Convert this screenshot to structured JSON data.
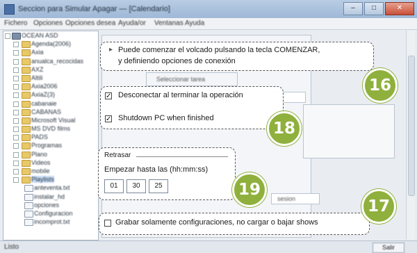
{
  "window": {
    "title": "Seccion para Simular Apagar — [Calendario]",
    "buttons": [
      "–",
      "□",
      "✕"
    ]
  },
  "menu": [
    "Fichero",
    "Opciones",
    "Opciones desea",
    "Ayuda/or",
    "Ventanas",
    "Ayuda"
  ],
  "tree": {
    "root": "OCEAN ASD",
    "items": [
      "Agenda(2006)",
      "Axia",
      "anualca_recocidas",
      "AXZ",
      "Altili",
      "Axia2006",
      "AxiaZ(3)",
      "cabanaie",
      "CABANAS",
      "Microsoft Visual",
      "MS DVD films",
      "PADS",
      "Programas",
      "Plano",
      "Videos",
      "mobile",
      "Playlists",
      "anteventa.txt",
      "instalar_hd",
      "opciones",
      "Configuracion",
      "incomprot.txt"
    ]
  },
  "background": {
    "group_label": "Seleccionar tarea",
    "side_label": "sesion",
    "statusbar_text": "Listo",
    "statusbar_button": "Salir"
  },
  "callouts": {
    "c16": {
      "line1": "Puede comenzar el volcado pulsando la tecla COMENZAR,",
      "line2": "y definiendo opciones de conexión",
      "number": "16"
    },
    "c18": {
      "option1": "Desconectar al terminar la operación",
      "option2": "Shutdown PC when finished",
      "number": "18"
    },
    "c19": {
      "group": "Retrasar",
      "label": "Empezar hasta las (hh:mm:ss)",
      "hh": "01",
      "mm": "30",
      "ss": "25",
      "number": "19"
    },
    "c17": {
      "text": "Grabar solamente configuraciones, no cargar o bajar shows",
      "number": "17"
    }
  },
  "colors": {
    "badge": "#8fb03c",
    "titlebar": "#a9c0dc"
  }
}
